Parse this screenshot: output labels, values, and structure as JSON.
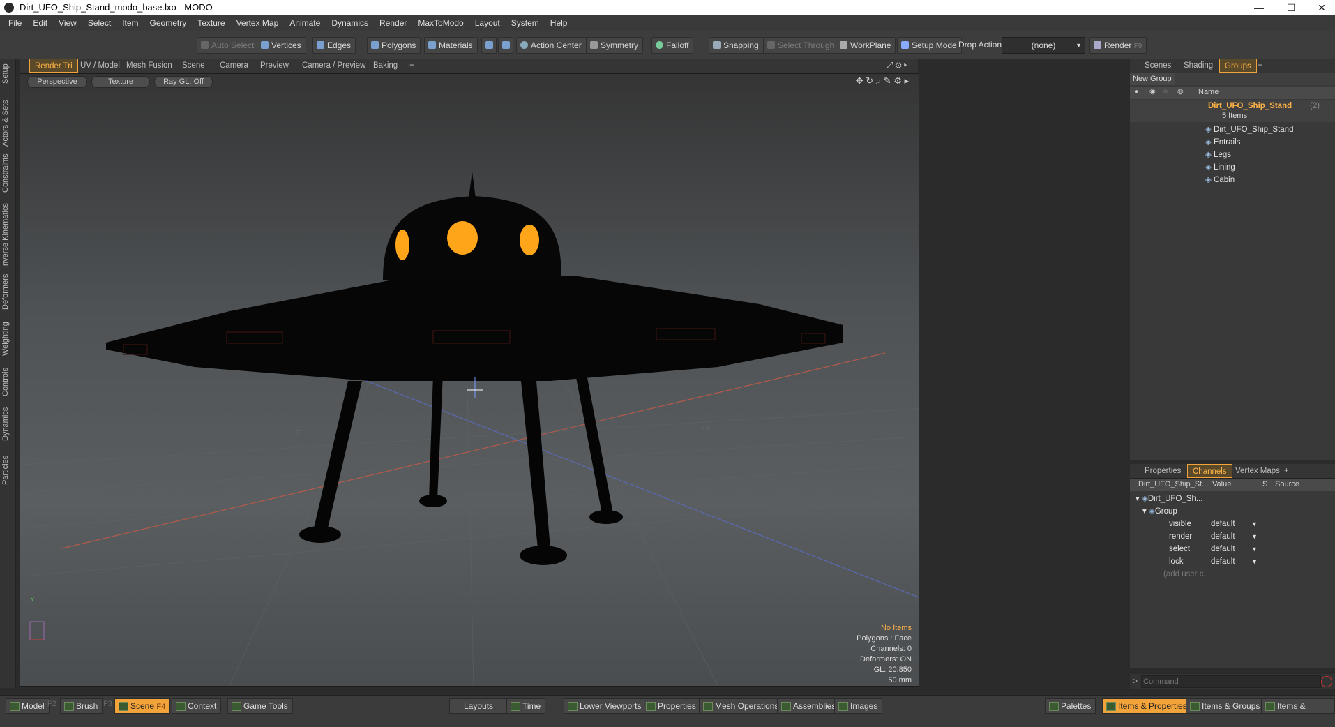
{
  "window": {
    "title": "Dirt_UFO_Ship_Stand_modo_base.lxo - MODO",
    "minimize": "—",
    "maximize": "☐",
    "close": "✕"
  },
  "menu": [
    "File",
    "Edit",
    "View",
    "Select",
    "Item",
    "Geometry",
    "Texture",
    "Vertex Map",
    "Animate",
    "Dynamics",
    "Render",
    "MaxToModo",
    "Layout",
    "System",
    "Help"
  ],
  "toolbar": {
    "auto_select": "Auto Select",
    "vertices": "Vertices",
    "edges": "Edges",
    "polygons": "Polygons",
    "materials": "Materials",
    "action_center": "Action Center",
    "symmetry": "Symmetry",
    "falloff": "Falloff",
    "snapping": "Snapping",
    "select_through": "Select Through",
    "workplane": "WorkPlane",
    "setup_mode": "Setup Mode",
    "drop_action": "Drop Action",
    "drop_value": "(none)",
    "render": "Render",
    "render_key": "F9"
  },
  "left_tabs": [
    "Setup",
    "Actors & Sets",
    "Constraints",
    "Inverse Kinematics",
    "Deformers",
    "Weighting",
    "Controls",
    "Dynamics",
    "Particles"
  ],
  "viewport_tabs": [
    "Render Tri",
    "UV / Model",
    "Mesh Fusion",
    "Scene",
    "Camera",
    "Preview",
    "Camera / Preview",
    "Baking",
    "+"
  ],
  "viewport": {
    "perspective": "Perspective",
    "texture": "Texture",
    "raygl": "Ray GL: Off",
    "axis_minus_z": "-Z",
    "axis_plus_x": "+X",
    "axis_y": "Y",
    "info": {
      "no_items": "No Items",
      "polygons": "Polygons : Face",
      "channels": "Channels: 0",
      "deformers": "Deformers: ON",
      "gl": "GL: 20,850",
      "lens": "50 mm"
    }
  },
  "scene_tabs": [
    "Scenes",
    "Shading",
    "Groups",
    "+"
  ],
  "groups": {
    "new_group": "New Group",
    "name_header": "Name",
    "root": "Dirt_UFO_Ship_Stand",
    "root_count": "(2)",
    "items_count": "5 Items",
    "children": [
      "Dirt_UFO_Ship_Stand",
      "Entrails",
      "Legs",
      "Lining",
      "Cabin"
    ]
  },
  "prop_tabs": [
    "Properties",
    "Channels",
    "Vertex Maps",
    "+"
  ],
  "channels": {
    "headers": [
      "Dirt_UFO_Ship_St...",
      "Value",
      "S",
      "Source"
    ],
    "item": "Dirt_UFO_Sh...",
    "group": "Group",
    "rows": [
      {
        "name": "visible",
        "value": "default"
      },
      {
        "name": "render",
        "value": "default"
      },
      {
        "name": "select",
        "value": "default"
      },
      {
        "name": "lock",
        "value": "default"
      }
    ],
    "add_user": "(add user c..."
  },
  "command": {
    "placeholder": "Command",
    "prompt": ">"
  },
  "bottom": {
    "model": "Model",
    "model_key": "F2",
    "brush": "Brush",
    "brush_key": "F3",
    "scene": "Scene",
    "scene_key": "F4",
    "context": "Context",
    "game_tools": "Game Tools",
    "layouts": "Layouts",
    "time": "Time",
    "lower_viewports": "Lower Viewports",
    "properties": "Properties",
    "mesh_operations": "Mesh Operations",
    "assemblies": "Assemblies",
    "images": "Images",
    "palettes": "Palettes",
    "items_properties": "Items & Properties",
    "items_groups": "Items & Groups",
    "items_shading": "Items & Shading"
  },
  "colors": {
    "accent": "#f2a33a",
    "window_glow": "#ffa51a"
  }
}
